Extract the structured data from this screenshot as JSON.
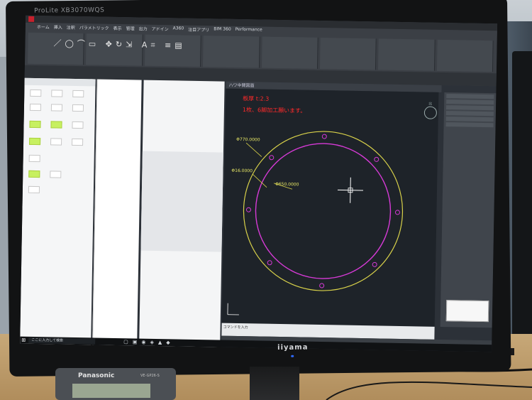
{
  "monitor": {
    "model": "ProLite XB3070WQS",
    "brand": "iiyama"
  },
  "autocad": {
    "ribbon_tabs": [
      "ホーム",
      "挿入",
      "注釈",
      "パラメトリック",
      "表示",
      "管理",
      "出力",
      "アドイン",
      "A360",
      "注目アプリ",
      "BIM 360",
      "Performance"
    ],
    "canvas_tab": "ハワ中間図面",
    "annotation_line1": "板厚 t:2.3",
    "annotation_line2": "1枚、6脚加工願います。",
    "dim_outer": "Φ770.0000",
    "dim_hole": "Φ16.0000",
    "dim_inner": "Φ650.0000",
    "viewcube_label": "北",
    "command_text": "コマンドを入力"
  },
  "taskbar": {
    "search_placeholder": "ここに入力して検索"
  },
  "colors": {
    "outer_circle": "#d9d24a",
    "inner_circle": "#d63ad6",
    "annotation": "#ff2a2a",
    "crosshair": "#ffffff"
  },
  "device": {
    "brand": "Panasonic",
    "model": "VE-GP26-S"
  }
}
